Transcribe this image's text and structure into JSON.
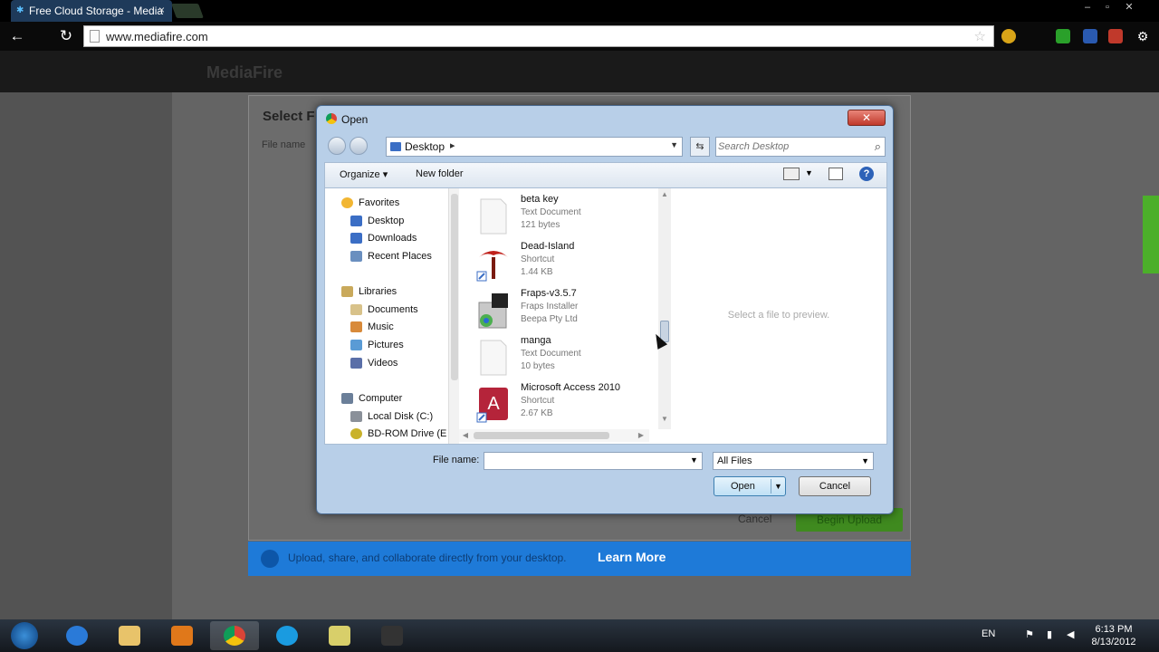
{
  "browser": {
    "tab_title": "Free Cloud Storage - Media",
    "tab_close": "×",
    "url": "www.mediafire.com"
  },
  "page": {
    "logo": "MediaFire",
    "mf_dialog_title": "Select F",
    "mf_filename_label": "File name",
    "mf_cancel": "Cancel",
    "mf_begin": "Begin Upload",
    "banner_text": "Upload, share, and collaborate directly from your desktop.",
    "banner_link": "Learn More"
  },
  "dialog": {
    "title": "Open",
    "close": "✕",
    "breadcrumb": "Desktop",
    "search_placeholder": "Search Desktop",
    "organize": "Organize ▾",
    "new_folder": "New folder",
    "help": "?",
    "nav": [
      {
        "label": "Favorites",
        "icon": "star-icon",
        "color": "#f2b632"
      },
      {
        "label": "Desktop",
        "icon": "desktop-icon",
        "color": "#3b6ec5"
      },
      {
        "label": "Downloads",
        "icon": "downloads-icon",
        "color": "#3b6ec5"
      },
      {
        "label": "Recent Places",
        "icon": "recent-places-icon",
        "color": "#6a8fbf"
      },
      {
        "label": "Libraries",
        "icon": "libraries-icon",
        "color": "#c9a95b"
      },
      {
        "label": "Documents",
        "icon": "documents-icon",
        "color": "#d8c28a"
      },
      {
        "label": "Music",
        "icon": "music-icon",
        "color": "#d88a3a"
      },
      {
        "label": "Pictures",
        "icon": "pictures-icon",
        "color": "#5a9bd5"
      },
      {
        "label": "Videos",
        "icon": "videos-icon",
        "color": "#5a6fa8"
      },
      {
        "label": "Computer",
        "icon": "computer-icon",
        "color": "#6b7f99"
      },
      {
        "label": "Local Disk (C:)",
        "icon": "disk-icon",
        "color": "#8a9099"
      },
      {
        "label": "BD-ROM Drive (E",
        "icon": "bd-rom-icon",
        "color": "#c9b22a"
      }
    ],
    "files": [
      {
        "name": "beta key",
        "type": "Text Document",
        "size": "121 bytes",
        "icon": "text-document-icon"
      },
      {
        "name": "Dead-Island",
        "type": "Shortcut",
        "size": "1.44 KB",
        "icon": "dead-island-shortcut-icon"
      },
      {
        "name": "Fraps-v3.5.7",
        "type": "Fraps Installer",
        "size": "Beepa Pty Ltd",
        "icon": "fraps-installer-icon"
      },
      {
        "name": "manga",
        "type": "Text Document",
        "size": "10 bytes",
        "icon": "text-document-icon"
      },
      {
        "name": "Microsoft Access 2010",
        "type": "Shortcut",
        "size": "2.67 KB",
        "icon": "access-shortcut-icon"
      }
    ],
    "preview_text": "Select a file to preview.",
    "file_name_label": "File name:",
    "file_name_value": "",
    "filter": "All Files",
    "open_label": "Open",
    "cancel_label": "Cancel"
  },
  "taskbar": {
    "language": "EN",
    "time": "6:13 PM",
    "date": "8/13/2012"
  },
  "colors": {
    "dialog_frame": "#b8cfe8",
    "close_red": "#c0392b",
    "mf_green": "#4caf2a",
    "mf_blue": "#1e7ad8"
  }
}
